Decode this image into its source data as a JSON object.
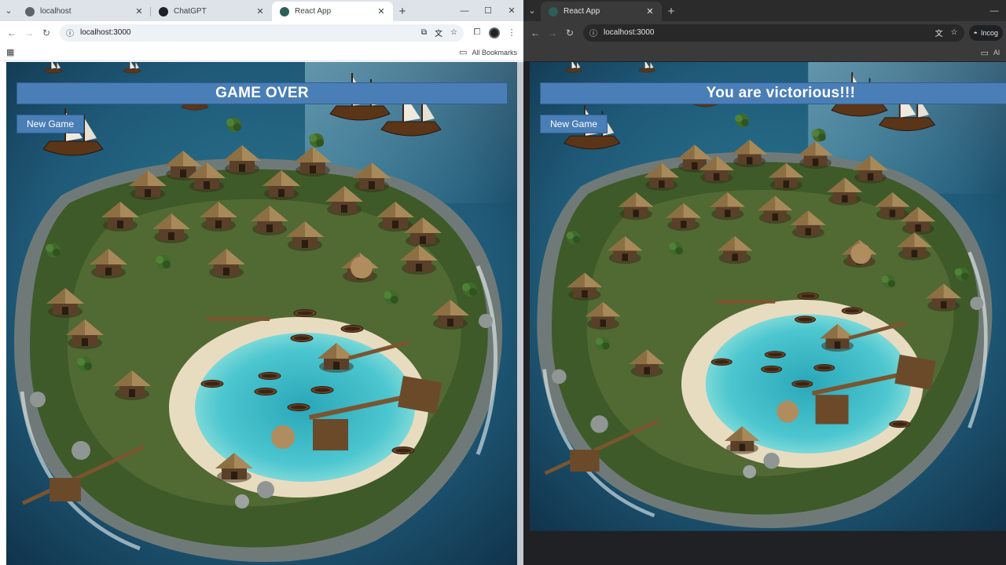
{
  "left_window": {
    "tabs": [
      {
        "label": "localhost",
        "favicon_color": "#5f6368",
        "active": false
      },
      {
        "label": "ChatGPT",
        "favicon_color": "#202124",
        "active": false
      },
      {
        "label": "React App",
        "favicon_color": "#2d5e5a",
        "active": true
      }
    ],
    "url": "localhost:3000",
    "bookmarks_label": "All Bookmarks",
    "game": {
      "banner_text": "GAME OVER",
      "new_game_label": "New Game"
    }
  },
  "right_window": {
    "tabs": [
      {
        "label": "React App",
        "favicon_color": "#2d5e5a",
        "active": true
      }
    ],
    "url": "localhost:3000",
    "profile_label": "Incog",
    "bookmarks_label": "Al",
    "game": {
      "banner_text": "You are victorious!!!",
      "new_game_label": "New Game"
    }
  },
  "colors": {
    "banner_bg": "#4a7eb6",
    "ocean_deep": "#1d4a66",
    "lagoon": "#3fb7c4",
    "sand": "#e8dcc0",
    "jungle": "#3e5a28"
  }
}
